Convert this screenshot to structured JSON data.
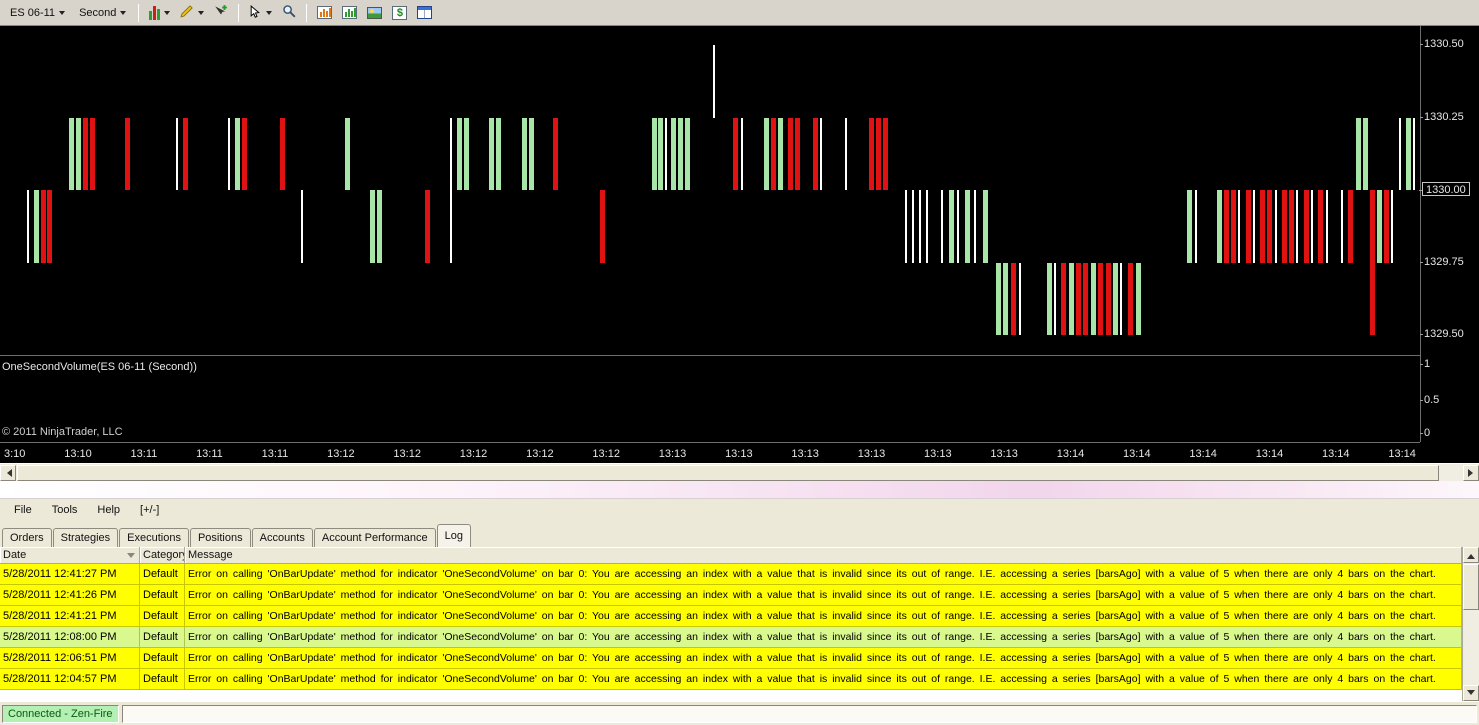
{
  "toolbar": {
    "instrument": "ES 06-11",
    "period": "Second",
    "chart_trader_glyph": "$",
    "icons": [
      "chart-style-icon",
      "drawing-tools-icon",
      "add-object-icon",
      "cursor-icon",
      "zoom-icon",
      "data-series-icon",
      "chart-panel-icon",
      "snapshot-icon",
      "chart-trader-icon",
      "properties-icon"
    ]
  },
  "chart": {
    "type": "ohlc-second-bars",
    "indicator_label": "OneSecondVolume(ES 06-11 (Second))",
    "copyright": "© 2011 NinjaTrader, LLC",
    "price_axis": {
      "labels": [
        "1330.50",
        "1330.25",
        "1330.00",
        "1329.75",
        "1329.50"
      ],
      "current": "1330.00"
    },
    "volume_axis": [
      "1",
      "0.5",
      "0"
    ],
    "time_axis": [
      "3:10",
      "13:10",
      "13:11",
      "13:11",
      "13:11",
      "13:12",
      "13:12",
      "13:12",
      "13:12",
      "13:12",
      "13:13",
      "13:13",
      "13:13",
      "13:13",
      "13:13",
      "13:13",
      "13:14",
      "13:14",
      "13:14",
      "13:14",
      "13:14",
      "13:14"
    ],
    "colors": {
      "g": "#a8e6a8",
      "r": "#e11212",
      "w": "#ffffff"
    },
    "bars": [
      [
        27,
        1330.0,
        1329.75,
        "w"
      ],
      [
        34,
        1330.0,
        1329.75,
        "g"
      ],
      [
        41,
        1330.0,
        1329.75,
        "r"
      ],
      [
        47,
        1330.0,
        1329.75,
        "r"
      ],
      [
        69,
        1330.25,
        1330.0,
        "g"
      ],
      [
        76,
        1330.25,
        1330.0,
        "g"
      ],
      [
        83,
        1330.25,
        1330.0,
        "r"
      ],
      [
        90,
        1330.25,
        1330.0,
        "r"
      ],
      [
        125,
        1330.25,
        1330.0,
        "r"
      ],
      [
        176,
        1330.25,
        1330.0,
        "w"
      ],
      [
        183,
        1330.25,
        1330.0,
        "r"
      ],
      [
        228,
        1330.25,
        1330.0,
        "w"
      ],
      [
        235,
        1330.25,
        1330.0,
        "g"
      ],
      [
        242,
        1330.25,
        1330.0,
        "r"
      ],
      [
        280,
        1330.25,
        1330.0,
        "r"
      ],
      [
        301,
        1330.0,
        1329.75,
        "w"
      ],
      [
        345,
        1330.25,
        1330.0,
        "g"
      ],
      [
        370,
        1330.0,
        1329.75,
        "g"
      ],
      [
        377,
        1330.0,
        1329.75,
        "g"
      ],
      [
        425,
        1330.0,
        1329.75,
        "r"
      ],
      [
        450,
        1330.25,
        1329.75,
        "w"
      ],
      [
        457,
        1330.25,
        1330.0,
        "g"
      ],
      [
        464,
        1330.25,
        1330.0,
        "g"
      ],
      [
        489,
        1330.25,
        1330.0,
        "g"
      ],
      [
        496,
        1330.25,
        1330.0,
        "g"
      ],
      [
        522,
        1330.25,
        1330.0,
        "g"
      ],
      [
        529,
        1330.25,
        1330.0,
        "g"
      ],
      [
        553,
        1330.25,
        1330.0,
        "r"
      ],
      [
        600,
        1330.0,
        1329.75,
        "r"
      ],
      [
        652,
        1330.25,
        1330.0,
        "g"
      ],
      [
        658,
        1330.25,
        1330.0,
        "g"
      ],
      [
        665,
        1330.25,
        1330.0,
        "w"
      ],
      [
        671,
        1330.25,
        1330.0,
        "g"
      ],
      [
        678,
        1330.25,
        1330.0,
        "g"
      ],
      [
        685,
        1330.25,
        1330.0,
        "g"
      ],
      [
        713,
        1330.5,
        1330.25,
        "w"
      ],
      [
        733,
        1330.25,
        1330.0,
        "r"
      ],
      [
        741,
        1330.25,
        1330.0,
        "w"
      ],
      [
        764,
        1330.25,
        1330.0,
        "g"
      ],
      [
        771,
        1330.25,
        1330.0,
        "r"
      ],
      [
        778,
        1330.25,
        1330.0,
        "g"
      ],
      [
        788,
        1330.25,
        1330.0,
        "r"
      ],
      [
        795,
        1330.25,
        1330.0,
        "r"
      ],
      [
        813,
        1330.25,
        1330.0,
        "r"
      ],
      [
        820,
        1330.25,
        1330.0,
        "w"
      ],
      [
        845,
        1330.25,
        1330.0,
        "w"
      ],
      [
        869,
        1330.25,
        1330.0,
        "r"
      ],
      [
        876,
        1330.25,
        1330.0,
        "r"
      ],
      [
        883,
        1330.25,
        1330.0,
        "r"
      ],
      [
        905,
        1330.0,
        1329.75,
        "w"
      ],
      [
        912,
        1330.0,
        1329.75,
        "w"
      ],
      [
        919,
        1330.0,
        1329.75,
        "w"
      ],
      [
        926,
        1330.0,
        1329.75,
        "w"
      ],
      [
        941,
        1330.0,
        1329.75,
        "w"
      ],
      [
        949,
        1330.0,
        1329.75,
        "g"
      ],
      [
        957,
        1330.0,
        1329.75,
        "w"
      ],
      [
        965,
        1330.0,
        1329.75,
        "g"
      ],
      [
        974,
        1330.0,
        1329.75,
        "w"
      ],
      [
        983,
        1330.0,
        1329.75,
        "g"
      ],
      [
        996,
        1329.75,
        1329.5,
        "g"
      ],
      [
        1003,
        1329.75,
        1329.5,
        "g"
      ],
      [
        1011,
        1329.75,
        1329.5,
        "r"
      ],
      [
        1019,
        1329.75,
        1329.5,
        "w"
      ],
      [
        1047,
        1329.75,
        1329.5,
        "g"
      ],
      [
        1054,
        1329.75,
        1329.5,
        "w"
      ],
      [
        1061,
        1329.75,
        1329.5,
        "r"
      ],
      [
        1069,
        1329.75,
        1329.5,
        "g"
      ],
      [
        1076,
        1329.75,
        1329.5,
        "r"
      ],
      [
        1083,
        1329.75,
        1329.5,
        "r"
      ],
      [
        1091,
        1329.75,
        1329.5,
        "g"
      ],
      [
        1098,
        1329.75,
        1329.5,
        "r"
      ],
      [
        1106,
        1329.75,
        1329.5,
        "r"
      ],
      [
        1113,
        1329.75,
        1329.5,
        "g"
      ],
      [
        1120,
        1329.75,
        1329.5,
        "w"
      ],
      [
        1128,
        1329.75,
        1329.5,
        "r"
      ],
      [
        1136,
        1329.75,
        1329.5,
        "g"
      ],
      [
        1187,
        1330.0,
        1329.75,
        "g"
      ],
      [
        1195,
        1330.0,
        1329.75,
        "w"
      ],
      [
        1217,
        1330.0,
        1329.75,
        "g"
      ],
      [
        1224,
        1330.0,
        1329.75,
        "r"
      ],
      [
        1231,
        1330.0,
        1329.75,
        "r"
      ],
      [
        1238,
        1330.0,
        1329.75,
        "w"
      ],
      [
        1246,
        1330.0,
        1329.75,
        "r"
      ],
      [
        1253,
        1330.0,
        1329.75,
        "w"
      ],
      [
        1260,
        1330.0,
        1329.75,
        "r"
      ],
      [
        1267,
        1330.0,
        1329.75,
        "r"
      ],
      [
        1275,
        1330.0,
        1329.75,
        "w"
      ],
      [
        1282,
        1330.0,
        1329.75,
        "r"
      ],
      [
        1289,
        1330.0,
        1329.75,
        "r"
      ],
      [
        1296,
        1330.0,
        1329.75,
        "w"
      ],
      [
        1304,
        1330.0,
        1329.75,
        "r"
      ],
      [
        1311,
        1330.0,
        1329.75,
        "w"
      ],
      [
        1318,
        1330.0,
        1329.75,
        "r"
      ],
      [
        1326,
        1330.0,
        1329.75,
        "w"
      ],
      [
        1341,
        1330.0,
        1329.75,
        "w"
      ],
      [
        1348,
        1330.0,
        1329.75,
        "r"
      ],
      [
        1356,
        1330.25,
        1330.0,
        "g"
      ],
      [
        1363,
        1330.25,
        1330.0,
        "g"
      ],
      [
        1370,
        1330.0,
        1329.5,
        "r"
      ],
      [
        1377,
        1330.0,
        1329.75,
        "g"
      ],
      [
        1384,
        1330.0,
        1329.75,
        "r"
      ],
      [
        1391,
        1330.0,
        1329.75,
        "w"
      ],
      [
        1399,
        1330.25,
        1330.0,
        "w"
      ],
      [
        1406,
        1330.25,
        1330.0,
        "g"
      ],
      [
        1413,
        1330.25,
        1330.0,
        "w"
      ]
    ]
  },
  "control_center": {
    "menu": [
      "File",
      "Tools",
      "Help",
      "[+/-]"
    ],
    "tabs": [
      {
        "label": "Orders"
      },
      {
        "label": "Strategies"
      },
      {
        "label": "Executions"
      },
      {
        "label": "Positions"
      },
      {
        "label": "Accounts"
      },
      {
        "label": "Account Performance"
      },
      {
        "label": "Log",
        "active": true
      }
    ],
    "log": {
      "columns": [
        "Date",
        "Category",
        "Message"
      ],
      "rows": [
        {
          "date": "5/28/2011 12:41:27 PM",
          "category": "Default",
          "row_color": "#ffff00",
          "message": "Error on calling 'OnBarUpdate' method for indicator 'OneSecondVolume' on bar 0: You are accessing an index with a value that is invalid since its out of range. I.E. accessing a series [barsAgo] with a value of 5 when there are only 4 bars on the chart."
        },
        {
          "date": "5/28/2011 12:41:26 PM",
          "category": "Default",
          "row_color": "#ffff00",
          "message": "Error on calling 'OnBarUpdate' method for indicator 'OneSecondVolume' on bar 0: You are accessing an index with a value that is invalid since its out of range. I.E. accessing a series [barsAgo] with a value of 5 when there are only 4 bars on the chart."
        },
        {
          "date": "5/28/2011 12:41:21 PM",
          "category": "Default",
          "row_color": "#ffff00",
          "message": "Error on calling 'OnBarUpdate' method for indicator 'OneSecondVolume' on bar 0: You are accessing an index with a value that is invalid since its out of range. I.E. accessing a series [barsAgo] with a value of 5 when there are only 4 bars on the chart."
        },
        {
          "date": "5/28/2011 12:08:00 PM",
          "category": "Default",
          "row_color": "#d9f98e",
          "message": "Error on calling 'OnBarUpdate' method for indicator 'OneSecondVolume' on bar 0: You are accessing an index with a value that is invalid since its out of range. I.E. accessing a series [barsAgo] with a value of 5 when there are only 4 bars on the chart."
        },
        {
          "date": "5/28/2011 12:06:51 PM",
          "category": "Default",
          "row_color": "#ffff00",
          "message": "Error on calling 'OnBarUpdate' method for indicator 'OneSecondVolume' on bar 0: You are accessing an index with a value that is invalid since its out of range. I.E. accessing a series [barsAgo] with a value of 5 when there are only 4 bars on the chart."
        },
        {
          "date": "5/28/2011 12:04:57 PM",
          "category": "Default",
          "row_color": "#ffff00",
          "message": "Error on calling 'OnBarUpdate' method for indicator 'OneSecondVolume' on bar 0: You are accessing an index with a value that is invalid since its out of range. I.E. accessing a series [barsAgo] with a value of 5 when there are only 4 bars on the chart."
        }
      ]
    },
    "status": "Connected - Zen-Fire"
  }
}
